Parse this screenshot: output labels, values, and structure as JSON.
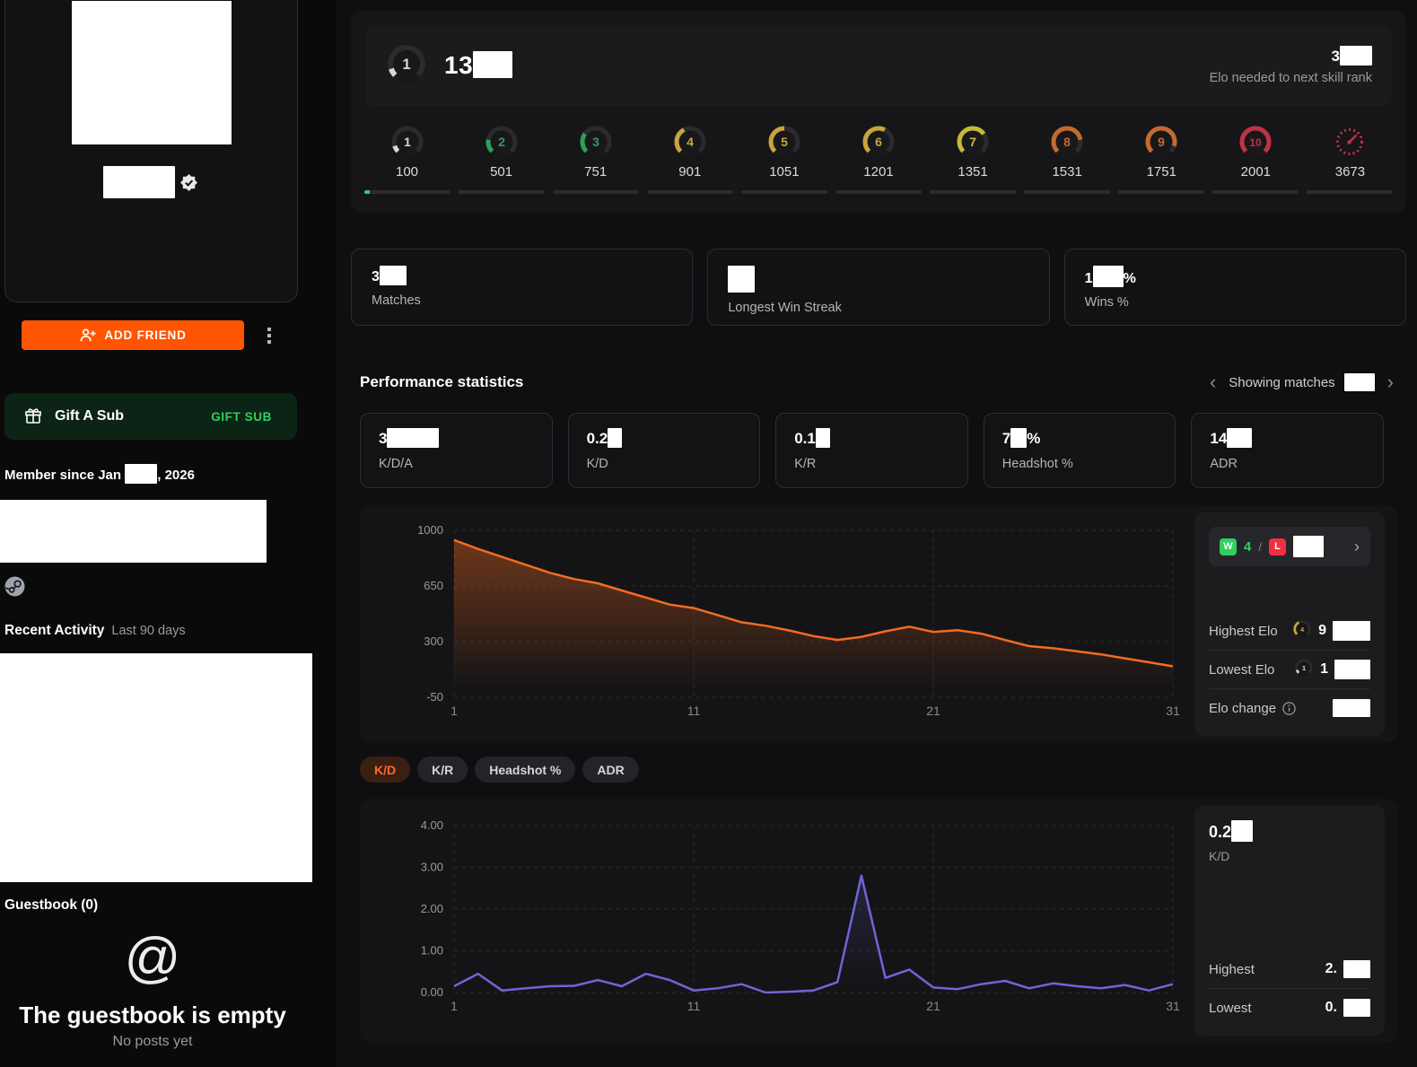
{
  "palette": {
    "orange": "#ff5500",
    "green": "#2fd05e",
    "red": "#f1303f",
    "chart_orange": "#f36c21",
    "chart_purple": "#6e66d6",
    "level_colors": {
      "1": "#d7d7d7",
      "2": "#2f9e5f",
      "3": "#2f9e5f",
      "4": "#c9a53a",
      "5": "#c9a53a",
      "6": "#c9a53a",
      "7": "#c9b83a",
      "8": "#c56a2e",
      "9": "#c56a2e",
      "10": "#c13245",
      "max": "#c13245"
    }
  },
  "sidebar": {
    "add_friend_label": "ADD FRIEND",
    "gift_title": "Gift A Sub",
    "gift_button": "GIFT SUB",
    "member_since_prefix": "Member since Jan",
    "member_since_suffix": ", 2026",
    "recent_activity_title": "Recent Activity",
    "recent_activity_period": "Last 90 days",
    "guestbook_title": "Guestbook (0)",
    "at_glyph": "@",
    "guestbook_empty_title": "The guestbook is empty",
    "guestbook_empty_subtitle": "No posts yet"
  },
  "header": {
    "skill_level": "1",
    "elo_visible": "13",
    "elo_needed_visible": "3",
    "elo_needed_label": "Elo needed to next skill rank",
    "ladder": [
      {
        "level": "1",
        "threshold": "100",
        "progress_pct": 7
      },
      {
        "level": "2",
        "threshold": "501",
        "progress_pct": 0
      },
      {
        "level": "3",
        "threshold": "751",
        "progress_pct": 0
      },
      {
        "level": "4",
        "threshold": "901",
        "progress_pct": 0
      },
      {
        "level": "5",
        "threshold": "1051",
        "progress_pct": 0
      },
      {
        "level": "6",
        "threshold": "1201",
        "progress_pct": 0
      },
      {
        "level": "7",
        "threshold": "1351",
        "progress_pct": 0
      },
      {
        "level": "8",
        "threshold": "1531",
        "progress_pct": 0
      },
      {
        "level": "9",
        "threshold": "1751",
        "progress_pct": 0
      },
      {
        "level": "10",
        "threshold": "2001",
        "progress_pct": 0
      },
      {
        "level": "max",
        "threshold": "3673",
        "progress_pct": 0
      }
    ]
  },
  "summary": {
    "matches_visible": "3",
    "matches_label": "Matches",
    "streak_label": "Longest Win Streak",
    "wins_visible": "1",
    "wins_suffix": "%",
    "wins_label": "Wins %"
  },
  "performance": {
    "title": "Performance statistics",
    "nav": {
      "prev": "‹",
      "next": "›",
      "showing_label": "Showing matches"
    },
    "stat_cards": [
      {
        "value": "3",
        "label": "K/D/A"
      },
      {
        "value": "0.2",
        "label": "K/D"
      },
      {
        "value": "0.1",
        "label": "K/R"
      },
      {
        "value": "7",
        "suffix": "%",
        "label": "Headshot %"
      },
      {
        "value": "14",
        "label": "ADR"
      }
    ],
    "elo_panel": {
      "win_badge": "W",
      "win_count": "4",
      "separator": "/",
      "loss_badge": "L",
      "chevron": "›",
      "highest_label": "Highest Elo",
      "highest_level": "4",
      "highest_visible": "9",
      "lowest_label": "Lowest Elo",
      "lowest_level": "1",
      "lowest_visible": "1",
      "change_label": "Elo change",
      "info_glyph": "i"
    },
    "tabs": [
      {
        "label": "K/D",
        "active": true
      },
      {
        "label": "K/R",
        "active": false
      },
      {
        "label": "Headshot %",
        "active": false
      },
      {
        "label": "ADR",
        "active": false
      }
    ],
    "kd_panel": {
      "value_visible": "0.2",
      "label": "K/D",
      "highest_label": "Highest",
      "highest_visible": "2.",
      "lowest_label": "Lowest",
      "lowest_visible": "0."
    }
  },
  "chart_data": [
    {
      "type": "line",
      "name": "elo-history",
      "x": [
        1,
        2,
        3,
        4,
        5,
        6,
        7,
        8,
        9,
        10,
        11,
        12,
        13,
        14,
        15,
        16,
        17,
        18,
        19,
        20,
        21,
        22,
        23,
        24,
        25,
        26,
        27,
        28,
        29,
        30,
        31
      ],
      "values": [
        939,
        883,
        833,
        783,
        733,
        694,
        667,
        622,
        578,
        533,
        511,
        467,
        422,
        400,
        370,
        335,
        311,
        330,
        365,
        394,
        361,
        372,
        350,
        310,
        272,
        258,
        239,
        220,
        195,
        170,
        145
      ],
      "x_range": [
        1,
        31
      ],
      "x_ticks": [
        1,
        11,
        21,
        31
      ],
      "ylim": [
        -50,
        1000
      ],
      "y_ticks": [
        1000,
        650,
        300,
        -50
      ],
      "y_tick_labels": [
        "1000",
        "650",
        "300",
        "-50"
      ],
      "line_color": "#f36c21",
      "fill_opacity": 0.4,
      "grid": "dashed",
      "legend": "none"
    },
    {
      "type": "line",
      "name": "kd-per-match",
      "x": [
        1,
        2,
        3,
        4,
        5,
        6,
        7,
        8,
        9,
        10,
        11,
        12,
        13,
        14,
        15,
        16,
        17,
        18,
        19,
        20,
        21,
        22,
        23,
        24,
        25,
        26,
        27,
        28,
        29,
        30,
        31
      ],
      "values": [
        0.15,
        0.45,
        0.05,
        0.1,
        0.15,
        0.16,
        0.3,
        0.15,
        0.45,
        0.3,
        0.05,
        0.1,
        0.2,
        0.0,
        0.02,
        0.05,
        0.25,
        2.8,
        0.35,
        0.55,
        0.12,
        0.08,
        0.2,
        0.28,
        0.1,
        0.22,
        0.15,
        0.1,
        0.18,
        0.05,
        0.2
      ],
      "x_range": [
        1,
        31
      ],
      "x_ticks": [
        1,
        11,
        21,
        31
      ],
      "ylim": [
        0,
        4
      ],
      "y_ticks": [
        4,
        3,
        2,
        1,
        0
      ],
      "y_tick_labels": [
        "4.00",
        "3.00",
        "2.00",
        "1.00",
        "0.00"
      ],
      "line_color": "#6e66d6",
      "fill_opacity": 0.2,
      "grid": "dashed",
      "legend": "none"
    }
  ]
}
